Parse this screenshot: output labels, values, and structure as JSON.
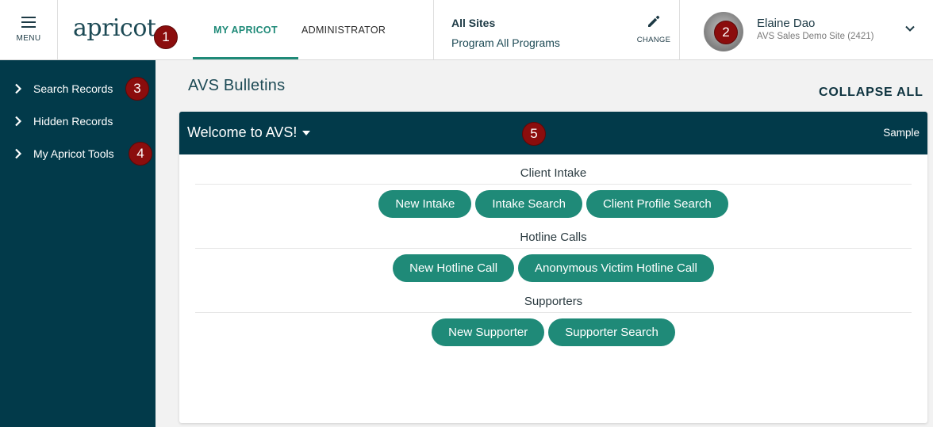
{
  "header": {
    "menu_label": "MENU",
    "logo_text": "apricot",
    "tabs": [
      {
        "label": "MY APRICOT",
        "active": true
      },
      {
        "label": "ADMINISTRATOR",
        "active": false
      }
    ],
    "sites": {
      "title": "All Sites",
      "program": "Program All Programs",
      "change_label": "CHANGE"
    },
    "user": {
      "name": "Elaine Dao",
      "site": "AVS Sales Demo Site (2421)"
    }
  },
  "callouts": [
    "1",
    "2",
    "3",
    "4",
    "5"
  ],
  "sidebar": {
    "items": [
      {
        "label": "Search Records"
      },
      {
        "label": "Hidden Records"
      },
      {
        "label": "My Apricot Tools"
      }
    ]
  },
  "main": {
    "title": "AVS Bulletins",
    "collapse_all": "COLLAPSE ALL",
    "bulletin": {
      "title": "Welcome to AVS!",
      "tag": "Sample",
      "sections": [
        {
          "heading": "Client Intake",
          "buttons": [
            "New Intake",
            "Intake Search",
            "Client Profile Search"
          ]
        },
        {
          "heading": "Hotline Calls",
          "buttons": [
            "New Hotline Call",
            "Anonymous Victim Hotline Call"
          ]
        },
        {
          "heading": "Supporters",
          "buttons": [
            "New Supporter",
            "Supporter Search"
          ]
        }
      ]
    }
  },
  "colors": {
    "navy": "#023a4a",
    "teal": "#1f8a78",
    "callout": "#8b0d0d"
  }
}
